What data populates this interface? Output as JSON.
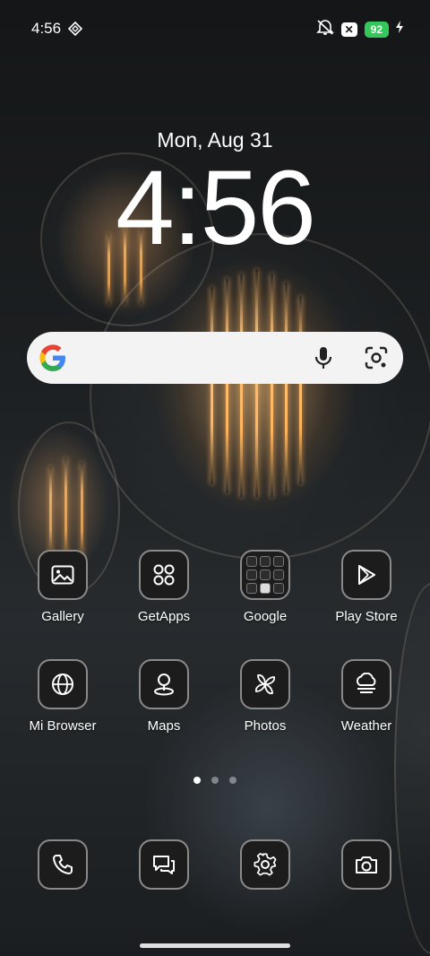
{
  "status_bar": {
    "time": "4:56",
    "battery_level": "92",
    "icons": [
      "diamond-icon",
      "mute-icon",
      "x-icon",
      "battery-icon",
      "charging-icon"
    ]
  },
  "lock_clock": {
    "date": "Mon, Aug 31",
    "time": "4:56"
  },
  "search_bar": {
    "icons": [
      "google-icon",
      "mic-icon",
      "lens-icon"
    ]
  },
  "apps_row1": [
    {
      "label": "Gallery",
      "icon": "gallery-icon"
    },
    {
      "label": "GetApps",
      "icon": "getapps-icon"
    },
    {
      "label": "Google",
      "icon": "folder-icon"
    },
    {
      "label": "Play Store",
      "icon": "play-store-icon"
    }
  ],
  "apps_row2": [
    {
      "label": "Mi Browser",
      "icon": "globe-icon"
    },
    {
      "label": "Maps",
      "icon": "map-pin-icon"
    },
    {
      "label": "Photos",
      "icon": "pinwheel-icon"
    },
    {
      "label": "Weather",
      "icon": "weather-icon"
    }
  ],
  "page_indicator": {
    "pages": 3,
    "current": 1
  },
  "dock": [
    {
      "icon": "phone-icon"
    },
    {
      "icon": "messages-icon"
    },
    {
      "icon": "settings-icon"
    },
    {
      "icon": "camera-icon"
    }
  ],
  "colors": {
    "battery": "#34c759",
    "search_bg": "#f3f3f3",
    "tile_bg": "#1c1c1c"
  }
}
